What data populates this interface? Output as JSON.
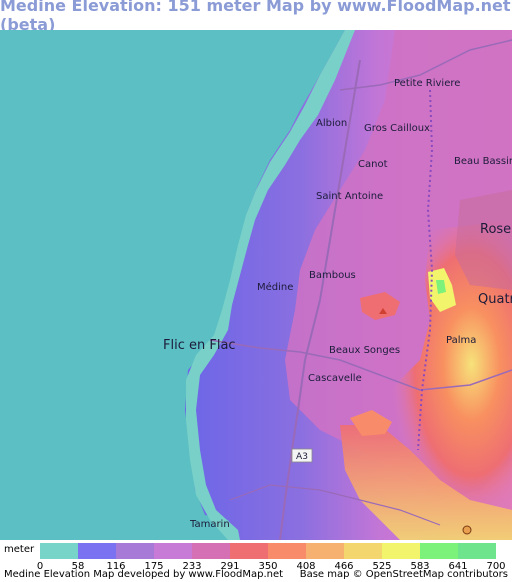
{
  "title": "Medine Elevation: 151 meter Map by www.FloodMap.net (beta)",
  "map": {
    "places": [
      {
        "name": "Petite Riviere",
        "size": 10
      },
      {
        "name": "Albion",
        "size": 10
      },
      {
        "name": "Gros Cailloux",
        "size": 10
      },
      {
        "name": "Canot",
        "size": 10
      },
      {
        "name": "Beau Bassin",
        "size": 10
      },
      {
        "name": "Saint Antoine",
        "size": 10
      },
      {
        "name": "Rose",
        "size": 13
      },
      {
        "name": "Bambous",
        "size": 10
      },
      {
        "name": "Médine",
        "size": 10
      },
      {
        "name": "Quatr",
        "size": 13
      },
      {
        "name": "Flic en Flac",
        "size": 13
      },
      {
        "name": "Palma",
        "size": 10
      },
      {
        "name": "Beaux Songes",
        "size": 10
      },
      {
        "name": "Cascavelle",
        "size": 10
      },
      {
        "name": "Tamarin",
        "size": 10
      }
    ],
    "road_label": "A3",
    "colors": {
      "sea": "#5bbfc3",
      "lowland": "#78d0c8"
    }
  },
  "legend": {
    "unit": "meter",
    "ticks": [
      "0",
      "58",
      "116",
      "175",
      "233",
      "291",
      "350",
      "408",
      "466",
      "525",
      "583",
      "641",
      "700"
    ],
    "colors": [
      "#76d4c8",
      "#7a72f0",
      "#a77ad8",
      "#c77ad6",
      "#d670b4",
      "#ef6e72",
      "#f88c6a",
      "#f6b070",
      "#f4d66e",
      "#f2f56c",
      "#7cf27a",
      "#6ee58c"
    ]
  },
  "footer": {
    "left": "Medine Elevation Map developed by www.FloodMap.net",
    "right": "Base map © OpenStreetMap contributors"
  }
}
